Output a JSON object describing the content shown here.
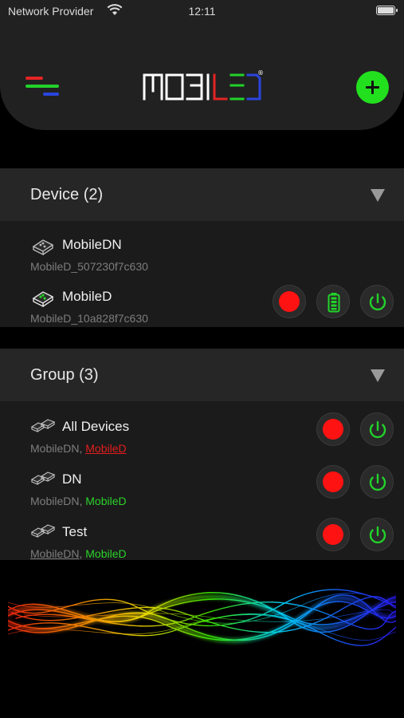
{
  "status_bar": {
    "carrier": "Network Provider",
    "time": "12:11"
  },
  "header": {
    "logo_text": "MOBILED",
    "logo_registered": "®"
  },
  "device_section": {
    "title": "Device (2)",
    "devices": [
      {
        "name": "MobileDN",
        "id": "MobileD_507230f7c630",
        "icon_state": "inactive"
      },
      {
        "name": "MobileD",
        "id": "MobileD_10a828f7c630",
        "icon_state": "active",
        "color": "#ff1212"
      }
    ]
  },
  "group_section": {
    "title": "Group (3)",
    "groups": [
      {
        "name": "All Devices",
        "member1": "MobileDN",
        "separator": ", ",
        "member2": "MobileD"
      },
      {
        "name": "DN",
        "member1": "MobileDN",
        "separator": ", ",
        "member2": "MobileD"
      },
      {
        "name": "Test",
        "member1": "MobileDN",
        "separator": ", ",
        "member2": "MobileD"
      }
    ]
  },
  "colors": {
    "accent_green": "#22e01e",
    "led_red": "#ff1212",
    "menu_red": "#e32424",
    "menu_green": "#22d22a",
    "menu_blue": "#2a45e0"
  },
  "icons": {
    "menu": "hamburger-menu-icon",
    "add": "plus-icon",
    "collapse": "triangle-down-icon",
    "power": "power-icon",
    "battery": "battery-full-icon",
    "device": "led-strip-icon"
  }
}
